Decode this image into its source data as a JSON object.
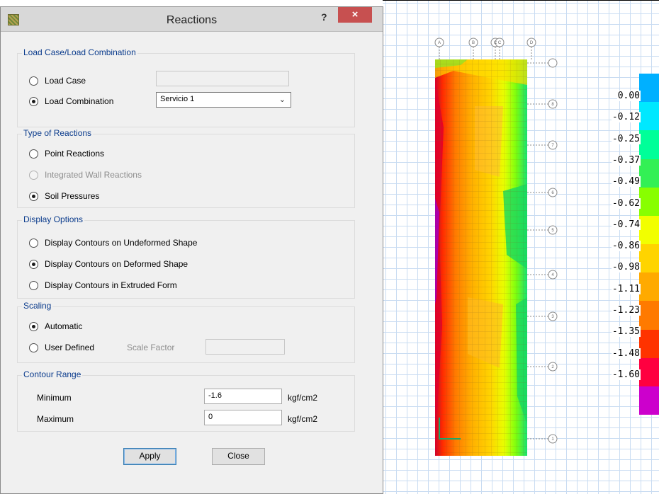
{
  "dialog": {
    "title": "Reactions",
    "help_glyph": "?",
    "close_glyph": "×",
    "load_case_group": {
      "title": "Load Case/Load Combination",
      "load_case_label": "Load Case",
      "load_case_value": "",
      "load_combination_label": "Load Combination",
      "load_combination_value": "Servicio 1",
      "selected": "Load Combination"
    },
    "reactions_group": {
      "title": "Type of Reactions",
      "options": [
        "Point Reactions",
        "Integrated Wall Reactions",
        "Soil Pressures"
      ],
      "selected": "Soil Pressures",
      "disabled": [
        "Integrated Wall Reactions"
      ]
    },
    "display_group": {
      "title": "Display Options",
      "options": [
        "Display Contours on Undeformed Shape",
        "Display Contours on Deformed Shape",
        "Display Contours in Extruded Form"
      ],
      "selected": "Display Contours on Deformed Shape"
    },
    "scaling_group": {
      "title": "Scaling",
      "automatic_label": "Automatic",
      "user_defined_label": "User Defined",
      "scale_factor_label": "Scale Factor",
      "scale_factor_value": "",
      "selected": "Automatic"
    },
    "contour_group": {
      "title": "Contour Range",
      "minimum_label": "Minimum",
      "minimum_value": "-1.6",
      "minimum_unit": "kgf/cm2",
      "maximum_label": "Maximum",
      "maximum_value": "0",
      "maximum_unit": "kgf/cm2"
    },
    "apply_label": "Apply",
    "close_label": "Close"
  },
  "plot": {
    "grid_column_labels": [
      "A",
      "B",
      "C",
      "C",
      "D"
    ],
    "grid_row_labels": [
      "8",
      "7",
      "6",
      "5",
      "4",
      "3",
      "2",
      "1"
    ],
    "legend_labels": [
      "0.00",
      "-0.12",
      "-0.25",
      "-0.37",
      "-0.49",
      "-0.62",
      "-0.74",
      "-0.86",
      "-0.98",
      "-1.11",
      "-1.23",
      "-1.35",
      "-1.48",
      "-1.60"
    ],
    "legend_colors": [
      "#00b0ff",
      "#00e8ff",
      "#00ff99",
      "#33f055",
      "#88ff00",
      "#f2ff00",
      "#ffd400",
      "#ffaa00",
      "#ff7a00",
      "#ff3300",
      "#ff0040",
      "#cc00cc"
    ]
  }
}
